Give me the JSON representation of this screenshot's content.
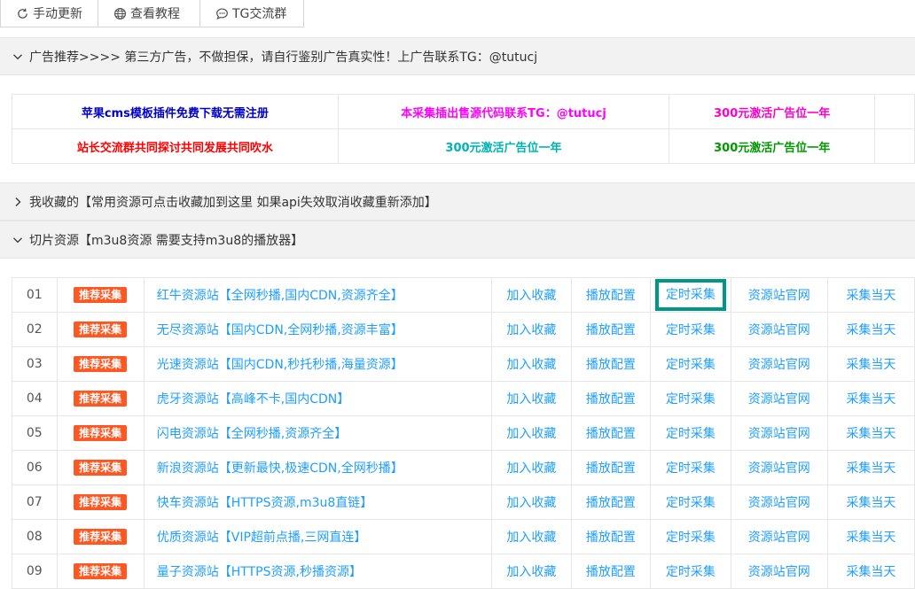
{
  "toolbar": {
    "buttons": [
      {
        "label": "手动更新",
        "icon": "refresh-icon"
      },
      {
        "label": "查看教程",
        "icon": "globe-icon"
      },
      {
        "label": "TG交流群",
        "icon": "chat-icon"
      }
    ]
  },
  "ad_panel": {
    "title": "广告推荐>>>>  第三方广告，不做担保，请自行鉴别广告真实性！上广告联系TG：@tutucj",
    "rows": [
      [
        {
          "text": "苹果cms模板插件免费下载无需注册",
          "color": "#0000cc"
        },
        {
          "text": "本采集插出售源代码联系TG：@tutucj",
          "color": "#ff00ff"
        },
        {
          "text": "300元激活广告位一年",
          "color": "#ff00cc"
        },
        {
          "text": "",
          "color": "#333333"
        }
      ],
      [
        {
          "text": "站长交流群共同探讨共同发展共同吹水",
          "color": "#ff0000"
        },
        {
          "text": "300元激活广告位一年",
          "color": "#00b3b3"
        },
        {
          "text": "300元激活广告位一年",
          "color": "#009900"
        },
        {
          "text": "",
          "color": "#333333"
        }
      ]
    ]
  },
  "favorites_panel": {
    "title": "我收藏的【常用资源可点击收藏加到这里 如果api失效取消收藏重新添加】"
  },
  "m3u8_panel": {
    "title": "切片资源【m3u8资源 需要支持m3u8的播放器】"
  },
  "resources": {
    "tag_label": "推荐采集",
    "actions": [
      "加入收藏",
      "播放配置",
      "定时采集",
      "资源站官网",
      "采集当天"
    ],
    "rows": [
      {
        "num": "01",
        "name": "红牛资源站【全网秒播,国内CDN,资源齐全】"
      },
      {
        "num": "02",
        "name": "无尽资源站【国内CDN,全网秒播,资源丰富】"
      },
      {
        "num": "03",
        "name": "光速资源站【国内CDN,秒托秒播,海量资源】"
      },
      {
        "num": "04",
        "name": "虎牙资源站【高峰不卡,国内CDN】"
      },
      {
        "num": "05",
        "name": "闪电资源站【全网秒播,资源齐全】"
      },
      {
        "num": "06",
        "name": "新浪资源站【更新最快,极速CDN,全网秒播】"
      },
      {
        "num": "07",
        "name": "快车资源站【HTTPS资源,m3u8直链】"
      },
      {
        "num": "08",
        "name": "优质资源站【VIP超前点播,三网直连】"
      },
      {
        "num": "09",
        "name": "量子资源站【HTTPS资源,秒播资源】"
      }
    ]
  },
  "colors": {
    "accent": "#1e9fff",
    "tag": "#ff5722",
    "highlight": "#009688"
  }
}
